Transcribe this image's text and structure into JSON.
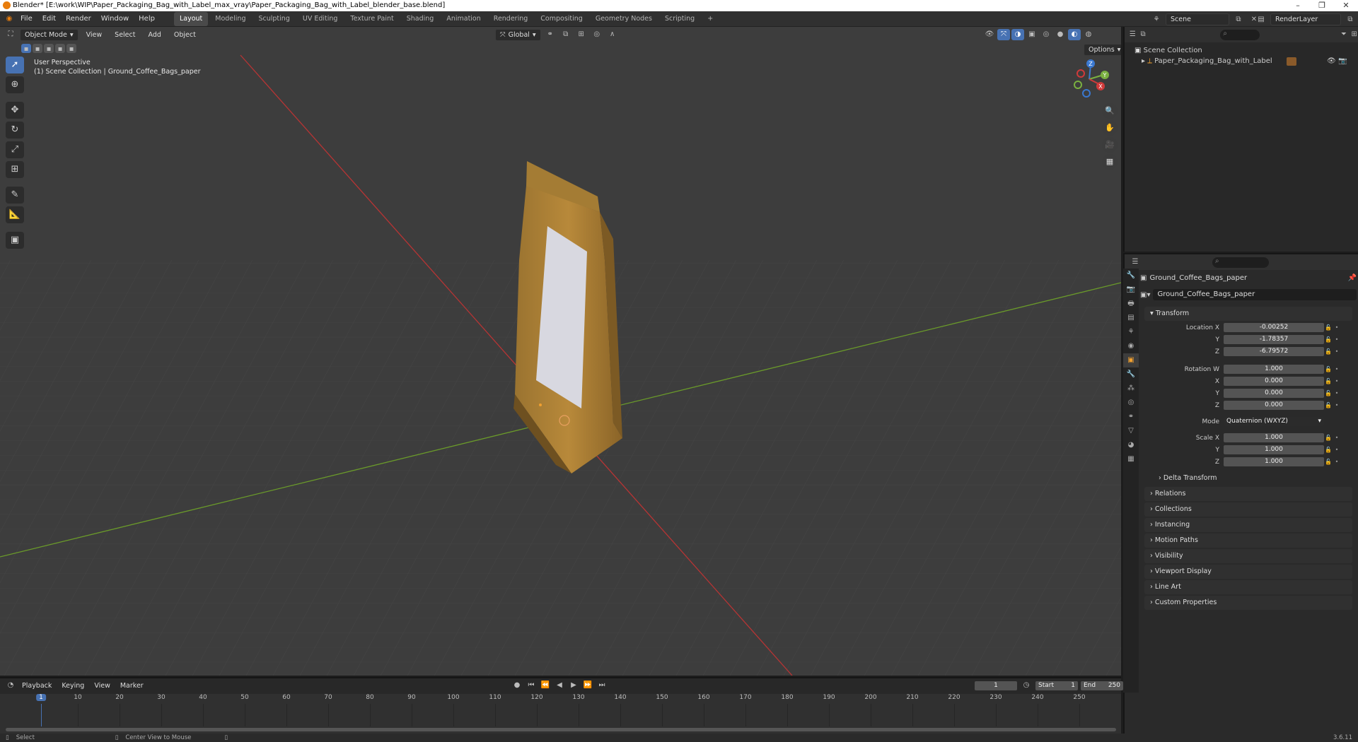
{
  "window": {
    "title": "Blender* [E:\\work\\WIP\\Paper_Packaging_Bag_with_Label_max_vray\\Paper_Packaging_Bag_with_Label_blender_base.blend]",
    "controls": [
      "–",
      "❐",
      "✕"
    ]
  },
  "menu": [
    "File",
    "Edit",
    "Render",
    "Window",
    "Help"
  ],
  "workspaces": [
    "Layout",
    "Modeling",
    "Sculpting",
    "UV Editing",
    "Texture Paint",
    "Shading",
    "Animation",
    "Rendering",
    "Compositing",
    "Geometry Nodes",
    "Scripting"
  ],
  "workspace_add": "+",
  "active_workspace": "Layout",
  "scene": {
    "name": "Scene",
    "render_layer": "RenderLayer"
  },
  "viewport": {
    "mode": "Object Mode",
    "menu": [
      "View",
      "Select",
      "Add",
      "Object"
    ],
    "orientation": "Global",
    "options_label": "Options",
    "perspective_label": "User Perspective",
    "collection_label": "(1) Scene Collection | Ground_Coffee_Bags_paper",
    "gizmo_axes": {
      "x": "X",
      "y": "Y",
      "z": "Z"
    },
    "colors": {
      "background": "#3d3d3d",
      "x_axis": "#c83232",
      "y_axis": "#6a9a2a",
      "bag": "#b8893a",
      "label": "#d8d8e0"
    }
  },
  "outliner": {
    "root": "Scene Collection",
    "items": [
      {
        "name": "Paper_Packaging_Bag_with_Label"
      }
    ]
  },
  "properties": {
    "object_name": "Ground_Coffee_Bags_paper",
    "data_name": "Ground_Coffee_Bags_paper",
    "transform_label": "Transform",
    "location": {
      "label": "Location X",
      "x": "-0.00252",
      "y_label": "Y",
      "y": "-1.78357",
      "z_label": "Z",
      "z": "-6.79572"
    },
    "rotation": {
      "label": "Rotation W",
      "w": "1.000",
      "x_label": "X",
      "x": "0.000",
      "y_label": "Y",
      "y": "0.000",
      "z_label": "Z",
      "z": "0.000"
    },
    "mode": {
      "label": "Mode",
      "value": "Quaternion (WXYZ)"
    },
    "scale": {
      "label": "Scale X",
      "x": "1.000",
      "y_label": "Y",
      "y": "1.000",
      "z_label": "Z",
      "z": "1.000"
    },
    "delta_transform": "Delta Transform",
    "panels": [
      "Relations",
      "Collections",
      "Instancing",
      "Motion Paths",
      "Visibility",
      "Viewport Display",
      "Line Art",
      "Custom Properties"
    ]
  },
  "timeline": {
    "menu": [
      "Playback",
      "Keying",
      "View",
      "Marker"
    ],
    "current_frame": "1",
    "start_label": "Start",
    "start": "1",
    "end_label": "End",
    "end": "250",
    "ticks": [
      "1",
      "10",
      "20",
      "30",
      "40",
      "50",
      "60",
      "70",
      "80",
      "90",
      "100",
      "110",
      "120",
      "130",
      "140",
      "150",
      "160",
      "170",
      "180",
      "190",
      "200",
      "210",
      "220",
      "230",
      "240",
      "250"
    ]
  },
  "status": {
    "select": "Select",
    "center": "Center View to Mouse",
    "version": "3.6.11"
  }
}
